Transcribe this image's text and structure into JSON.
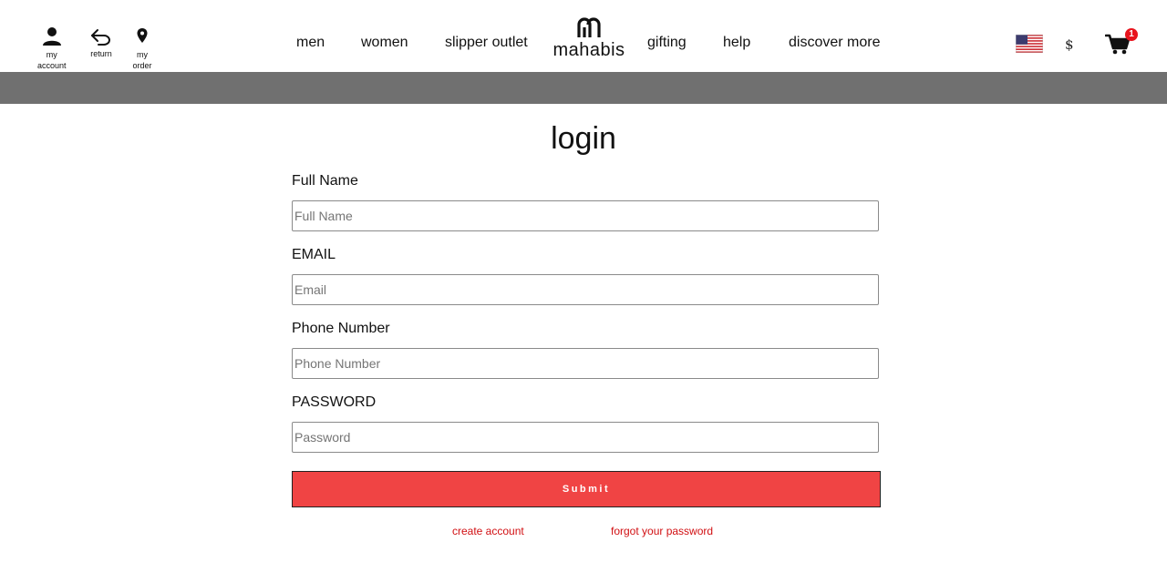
{
  "header": {
    "utility": {
      "account_line1": "my",
      "account_line2": "account",
      "return_label": "return",
      "order_line1": "my",
      "order_line2": "order"
    },
    "nav": [
      "men",
      "women",
      "slipper outlet",
      "gifting",
      "help",
      "discover more"
    ],
    "logo_text": "mahabis",
    "currency": "$",
    "cart_count": "1",
    "icons": {
      "account": "user-icon",
      "return": "return-arrow-icon",
      "order": "location-pin-icon",
      "flag": "us-flag-icon",
      "cart": "cart-icon"
    }
  },
  "login": {
    "title": "login",
    "fields": [
      {
        "label": "Full Name",
        "placeholder": "Full Name",
        "value": ""
      },
      {
        "label": "EMAIL",
        "placeholder": "Email",
        "value": ""
      },
      {
        "label": "Phone Number",
        "placeholder": "Phone Number",
        "value": ""
      },
      {
        "label": "PASSWORD",
        "placeholder": "Password",
        "value": ""
      }
    ],
    "submit_label": "Submit",
    "create_account_link": "create account",
    "forgot_password_link": "forgot your password"
  },
  "colors": {
    "accent": "#f04444",
    "link": "#d10f12",
    "band": "#707070",
    "badge": "#e8141d"
  }
}
